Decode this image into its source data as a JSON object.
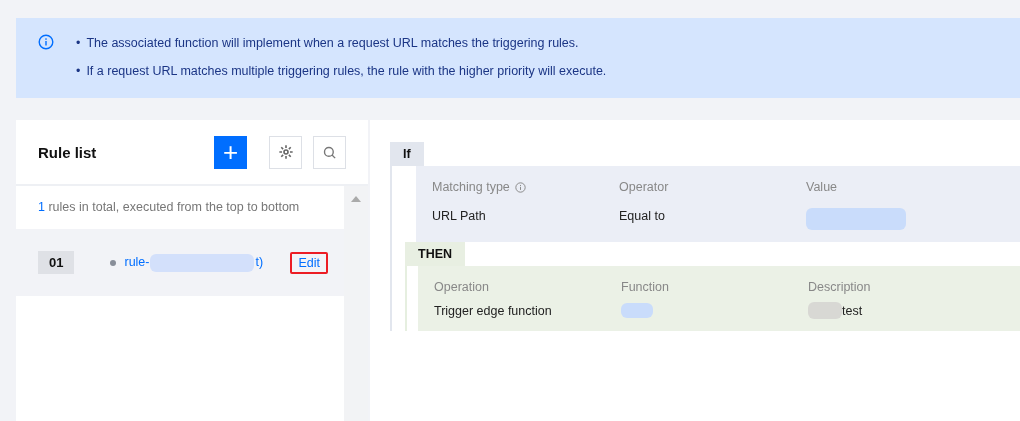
{
  "notice": {
    "items": [
      {
        "bullet": "•",
        "text": "The associated function will implement when a request URL matches the triggering rules."
      },
      {
        "bullet": "•",
        "text": "If a request URL matches multiple triggering rules, the rule with the higher priority will execute."
      }
    ]
  },
  "rule_list": {
    "title": "Rule list",
    "add_label": "+",
    "summary_count": "1",
    "summary_text": "rules in total, executed from the top to bottom",
    "rules": [
      {
        "index": "01",
        "name_start": "rule-",
        "name_end": "t)",
        "edit_label": "Edit",
        "edit_highlighted": true,
        "selected": true
      }
    ]
  },
  "condition": {
    "label": "If",
    "columns": [
      {
        "header": "Matching type",
        "info": true,
        "value": "URL Path"
      },
      {
        "header": "Operator",
        "info": false,
        "value": "Equal to"
      },
      {
        "header": "Value",
        "info": false,
        "value_redacted": true
      }
    ]
  },
  "action": {
    "label": "THEN",
    "columns": [
      {
        "header": "Operation",
        "value": "Trigger edge function"
      },
      {
        "header": "Function",
        "value_redacted": true
      },
      {
        "header": "Description",
        "value": "test",
        "value_redacted": true
      }
    ]
  }
}
